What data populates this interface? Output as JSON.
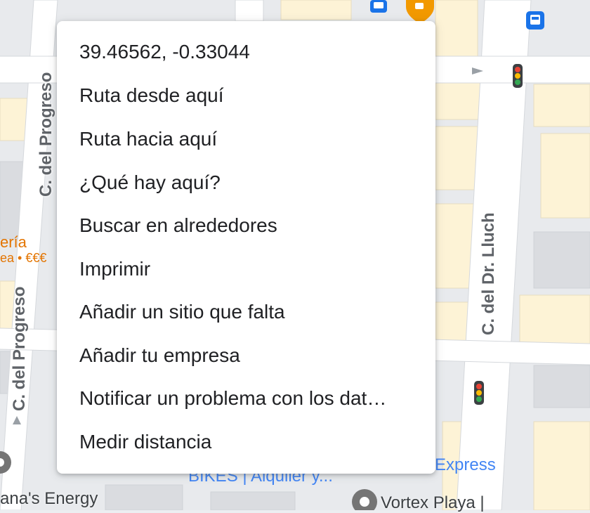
{
  "map": {
    "streets": [
      "C. del Progreso",
      "C. del Progreso",
      "C. del Dr. Lluch"
    ],
    "poi_partial": "ería",
    "poi_partial_sub": "ea • €€€",
    "bikes_label": "BIKES | Alquiler y...",
    "express_label": "Express",
    "energy_label": "ana's Energy",
    "vortex_label": "Vortex Playa |"
  },
  "context_menu": {
    "items": [
      "39.46562, -0.33044",
      "Ruta desde aquí",
      "Ruta hacia aquí",
      "¿Qué hay aquí?",
      "Buscar en alrededores",
      "Imprimir",
      "Añadir un sitio que falta",
      "Añadir tu empresa",
      "Notificar un problema con los dat…",
      "Medir distancia"
    ]
  },
  "colors": {
    "road": "#ffffff",
    "block": "#e8eaed",
    "building": "#fdf3d6",
    "poi_orange": "#e37400",
    "transit_blue": "#1a73e8"
  }
}
